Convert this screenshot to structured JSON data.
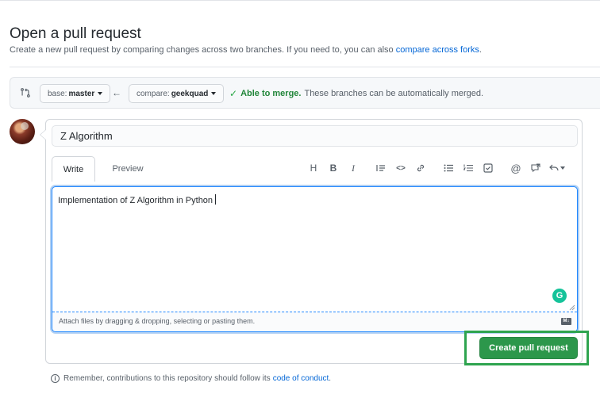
{
  "header": {
    "title": "Open a pull request",
    "subtitle": "Create a new pull request by comparing changes across two branches. If you need to, you can also",
    "subtitle_link": "compare across forks",
    "subtitle_end": "."
  },
  "range": {
    "base_label": "base:",
    "base_value": "master",
    "compare_label": "compare:",
    "compare_value": "geekquad",
    "merge_status": "Able to merge.",
    "merge_desc": "These branches can be automatically merged."
  },
  "form": {
    "title_value": "Z Algorithm",
    "tabs": [
      "Write",
      "Preview"
    ],
    "body_text": "Implementation of Z Algorithm in Python",
    "attach_hint": "Attach files by dragging & dropping, selecting or pasting them.",
    "markdown_badge": "M↓",
    "submit_label": "Create pull request"
  },
  "toolbar_icons": [
    "heading-icon",
    "bold-icon",
    "italic-icon",
    "quote-icon",
    "code-icon",
    "link-icon",
    "unordered-list-icon",
    "ordered-list-icon",
    "task-list-icon",
    "mention-icon",
    "reference-icon",
    "reply-icon"
  ],
  "toolbar_glyphs": {
    "heading": "H",
    "bold": "B",
    "italic": "I",
    "code": "<>"
  },
  "footer": {
    "note": "Remember, contributions to this repository should follow its",
    "link": "code of conduct",
    "end": "."
  },
  "colors": {
    "accent_link": "#0366d6",
    "merge_green": "#22863a",
    "button_green": "#2c974b",
    "highlight_green": "#2ea44f",
    "grammarly": "#15c39a"
  }
}
